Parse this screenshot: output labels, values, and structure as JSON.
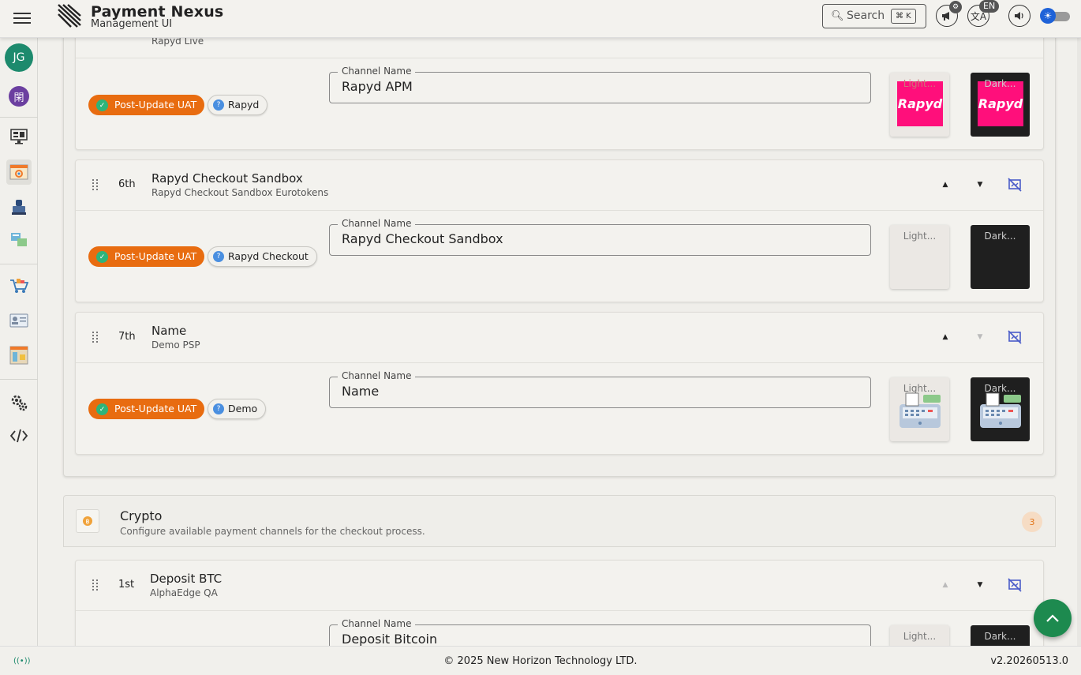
{
  "header": {
    "brand_title": "Payment Nexus",
    "brand_subtitle": "Management UI",
    "search_placeholder": "Search",
    "search_shortcut": "⌘ K",
    "language": "EN"
  },
  "sidebar": {
    "avatar_initials": "JG",
    "org_initial": "閑",
    "items": [
      "dashboard",
      "checkout-settings",
      "terminal",
      "integrations",
      "shop",
      "contacts",
      "reports",
      "settings",
      "developer"
    ]
  },
  "partial_top_subtitle": "Rapyd Live",
  "channels": [
    {
      "order": "",
      "title": "",
      "subtitle": "",
      "uat_label": "Post-Update UAT",
      "psp_label": "Rapyd",
      "field_label": "Channel Name",
      "channel_name": "Rapyd APM",
      "light_label": "Light...",
      "dark_label": "Dark...",
      "logo_text": "Rapyd"
    },
    {
      "order": "6th",
      "title": "Rapyd Checkout Sandbox",
      "subtitle": "Rapyd Checkout Sandbox Eurotokens",
      "uat_label": "Post-Update UAT",
      "psp_label": "Rapyd Checkout",
      "field_label": "Channel Name",
      "channel_name": "Rapyd Checkout Sandbox",
      "light_label": "Light...",
      "dark_label": "Dark..."
    },
    {
      "order": "7th",
      "title": "Name",
      "subtitle": "Demo PSP",
      "uat_label": "Post-Update UAT",
      "psp_label": "Demo",
      "field_label": "Channel Name",
      "channel_name": "Name",
      "light_label": "Light...",
      "dark_label": "Dark..."
    },
    {
      "order": "1st",
      "title": "Deposit BTC",
      "subtitle": "AlphaEdge QA",
      "field_label": "Channel Name",
      "channel_name": "Deposit Bitcoin",
      "light_label": "Light...",
      "dark_label": "Dark..."
    }
  ],
  "crypto_section": {
    "title": "Crypto",
    "subtitle": "Configure available payment channels for the checkout process.",
    "count": "3"
  },
  "footer": {
    "copyright": "© 2025 New Horizon Technology LTD.",
    "version": "v2.20260513.0"
  },
  "colors": {
    "uat_chip": "#e86c10",
    "accent_green": "#1d8a4f",
    "avatar": "#1d8a6d",
    "rapyd_pink": "#ff0f7b",
    "eye_off_icon": "#4a5cc9"
  }
}
